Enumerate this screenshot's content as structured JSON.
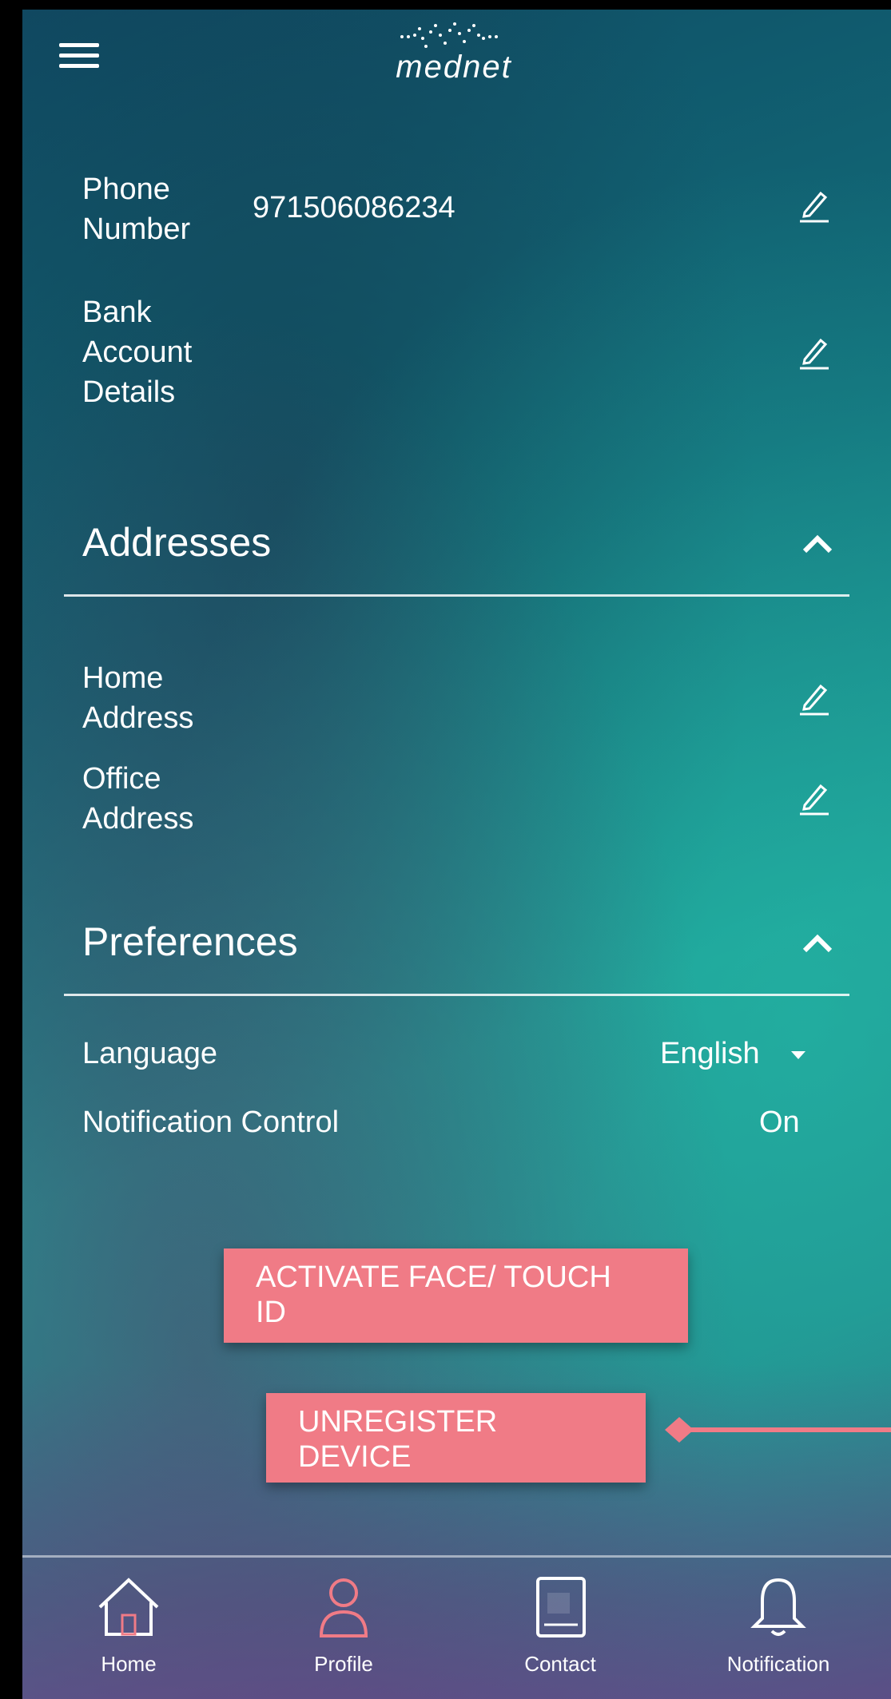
{
  "app": {
    "brand": "mednet"
  },
  "profile": {
    "phone_label": "Phone\nNumber",
    "phone_value": "971506086234",
    "bank_label": "Bank\nAccount\nDetails"
  },
  "addresses": {
    "title": "Addresses",
    "home_label": "Home\nAddress",
    "office_label": "Office\nAddress"
  },
  "preferences": {
    "title": "Preferences",
    "language_label": "Language",
    "language_value": "English",
    "notification_label": "Notification Control",
    "notification_value": "On"
  },
  "actions": {
    "activate_label": "ACTIVATE FACE/ TOUCH\nID",
    "unregister_label": "UNREGISTER\nDEVICE"
  },
  "tabs": [
    {
      "label": "Home",
      "icon": "home-icon"
    },
    {
      "label": "Profile",
      "icon": "profile-icon"
    },
    {
      "label": "Contact",
      "icon": "contact-icon"
    },
    {
      "label": "Notification",
      "icon": "bell-icon"
    }
  ],
  "colors": {
    "accent": "#f07b86",
    "text": "#ffffff"
  }
}
